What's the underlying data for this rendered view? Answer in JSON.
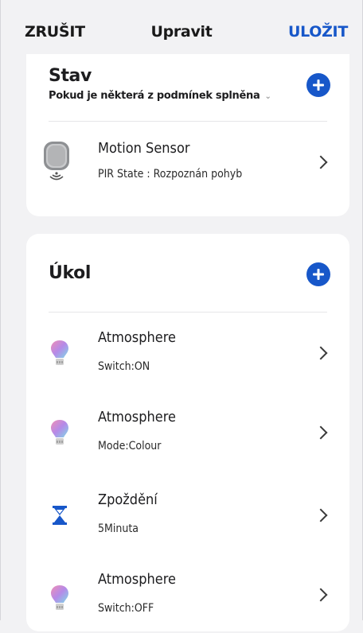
{
  "header": {
    "cancel_label": "ZRUŠIT",
    "title": "Upravit",
    "save_label": "ULOŽIT"
  },
  "condition_section": {
    "title": "Stav",
    "subtitle": "Pokud je některá z podmínek splněna",
    "items": [
      {
        "icon": "motion-sensor-icon",
        "name": "Motion Sensor",
        "detail": "PIR State : Rozpoznán pohyb"
      }
    ]
  },
  "task_section": {
    "title": "Úkol",
    "items": [
      {
        "icon": "bulb-icon",
        "name": "Atmosphere",
        "detail": "Switch:ON"
      },
      {
        "icon": "bulb-icon",
        "name": "Atmosphere",
        "detail": "Mode:Colour"
      },
      {
        "icon": "hourglass-icon",
        "name": "Zpoždění",
        "detail": "5Minuta"
      },
      {
        "icon": "bulb-icon",
        "name": "Atmosphere",
        "detail": "Switch:OFF"
      }
    ]
  },
  "colors": {
    "accent": "#1757c9",
    "background": "#f2f2f4",
    "card": "#ffffff"
  }
}
